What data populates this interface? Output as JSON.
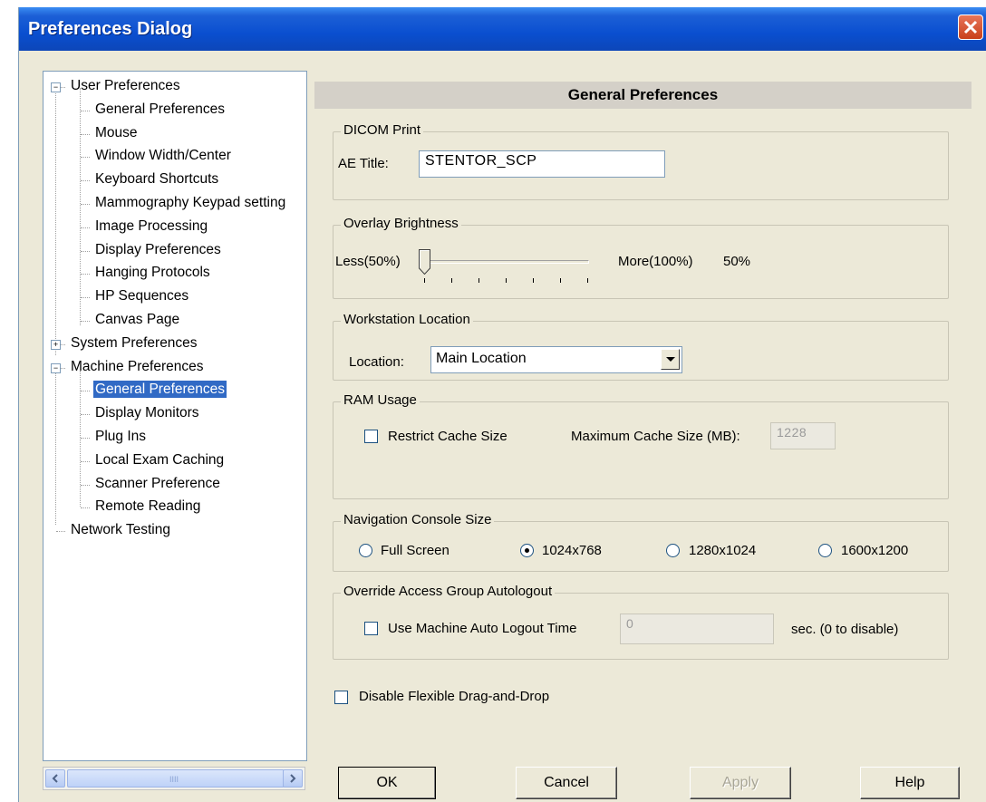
{
  "window": {
    "title": "Preferences Dialog"
  },
  "tree": {
    "items": [
      {
        "label": "User Preferences",
        "expander": "−"
      },
      {
        "label": "General Preferences"
      },
      {
        "label": "Mouse"
      },
      {
        "label": "Window Width/Center"
      },
      {
        "label": "Keyboard Shortcuts"
      },
      {
        "label": "Mammography Keypad setting"
      },
      {
        "label": "Image Processing"
      },
      {
        "label": "Display Preferences"
      },
      {
        "label": "Hanging Protocols"
      },
      {
        "label": "HP Sequences"
      },
      {
        "label": "Canvas Page"
      },
      {
        "label": "System Preferences",
        "expander": "+"
      },
      {
        "label": "Machine Preferences",
        "expander": "−"
      },
      {
        "label": "General Preferences",
        "selected": true
      },
      {
        "label": "Display Monitors"
      },
      {
        "label": "Plug Ins"
      },
      {
        "label": "Local Exam Caching"
      },
      {
        "label": "Scanner Preference"
      },
      {
        "label": "Remote Reading"
      },
      {
        "label": "Network Testing"
      }
    ],
    "scroll_grip": "IIII"
  },
  "panel": {
    "header": "General Preferences",
    "dicom": {
      "title": "DICOM Print",
      "ae_label": "AE Title:",
      "ae_value": "STENTOR_SCP"
    },
    "overlay": {
      "title": "Overlay Brightness",
      "less_label": "Less(50%)",
      "more_label": "More(100%)",
      "value_text": "50%",
      "value_fraction": 0.0
    },
    "location": {
      "title": "Workstation Location",
      "label": "Location:",
      "value": "Main Location"
    },
    "ram": {
      "title": "RAM Usage",
      "restrict_label": "Restrict Cache Size",
      "restrict_checked": false,
      "max_label": "Maximum Cache Size (MB):",
      "max_value": "1228"
    },
    "nav": {
      "title": "Navigation Console Size",
      "options": [
        {
          "label": "Full Screen",
          "checked": false
        },
        {
          "label": "1024x768",
          "checked": true
        },
        {
          "label": "1280x1024",
          "checked": false
        },
        {
          "label": "1600x1200",
          "checked": false
        }
      ]
    },
    "autologout": {
      "title": "Override Access Group Autologout",
      "use_label": "Use Machine Auto Logout Time",
      "use_checked": false,
      "value": "0",
      "suffix": "sec. (0 to disable)"
    },
    "drag_drop": {
      "label": "Disable Flexible Drag-and-Drop",
      "checked": false
    }
  },
  "buttons": {
    "ok": "OK",
    "cancel": "Cancel",
    "apply": "Apply",
    "help": "Help"
  },
  "colors": {
    "title_bar": "#0a4fd0",
    "selection": "#316ac5",
    "dialog_bg": "#ece9d8"
  }
}
